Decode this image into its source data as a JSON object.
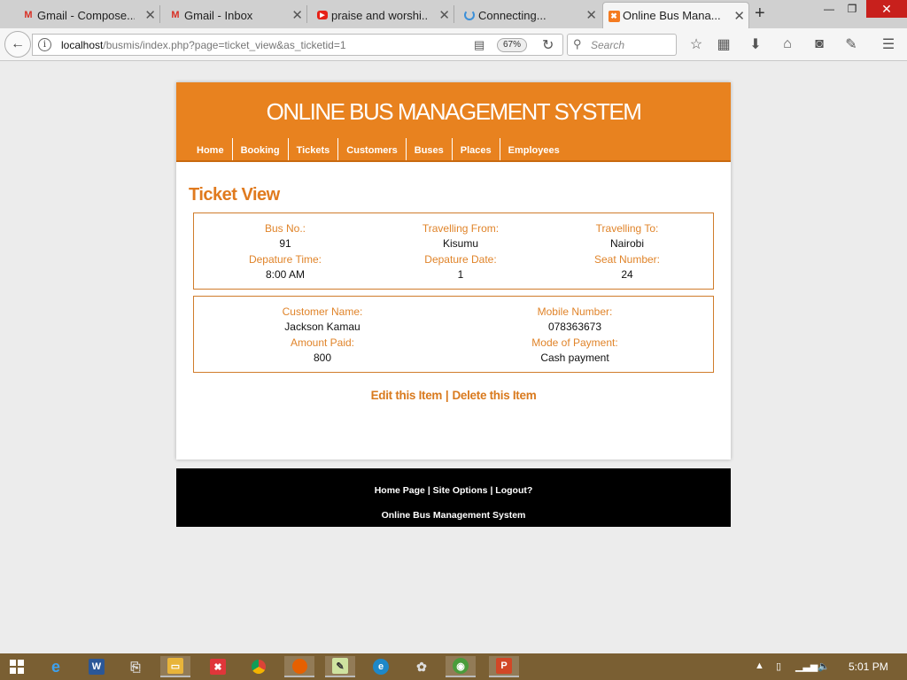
{
  "browser": {
    "tabs": [
      {
        "label": "Gmail - Compose...",
        "icon": "gmail-icon",
        "active": false
      },
      {
        "label": "Gmail - Inbox",
        "icon": "gmail-icon",
        "active": false
      },
      {
        "label": "praise and worshi...",
        "icon": "youtube-icon",
        "active": false
      },
      {
        "label": "Connecting...",
        "icon": "loading-icon",
        "active": false
      },
      {
        "label": "Online Bus Mana...",
        "icon": "xampp-icon",
        "active": true
      }
    ],
    "url_host": "localhost",
    "url_path": "/busmis/index.php?page=ticket_view&as_ticketid=1",
    "zoom": "67%",
    "search_placeholder": "Search"
  },
  "site": {
    "title": "ONLINE BUS MANAGEMENT SYSTEM",
    "nav": [
      "Home",
      "Booking",
      "Tickets",
      "Customers",
      "Buses",
      "Places",
      "Employees"
    ],
    "accent_color": "#e8821f"
  },
  "ticket": {
    "heading": "Ticket View",
    "trip": {
      "bus_no_label": "Bus No.:",
      "bus_no": "91",
      "from_label": "Travelling From:",
      "from": "Kisumu",
      "to_label": "Travelling To:",
      "to": "Nairobi",
      "dep_time_label": "Depature Time:",
      "dep_time": "8:00 AM",
      "dep_date_label": "Depature Date:",
      "dep_date": "1",
      "seat_label": "Seat Number:",
      "seat": "24"
    },
    "customer": {
      "name_label": "Customer Name:",
      "name": "Jackson Kamau",
      "mobile_label": "Mobile Number:",
      "mobile": "078363673",
      "amount_label": "Amount Paid:",
      "amount": "800",
      "payment_label": "Mode of Payment:",
      "payment": "Cash payment"
    },
    "edit_label": "Edit this Item",
    "separator": "|",
    "delete_label": "Delete this Item"
  },
  "footer": {
    "home": "Home Page",
    "options": "Site Options",
    "logout": "Logout?",
    "sep": "|",
    "title": "Online Bus Management System"
  },
  "taskbar": {
    "clock": "5:01 PM"
  }
}
